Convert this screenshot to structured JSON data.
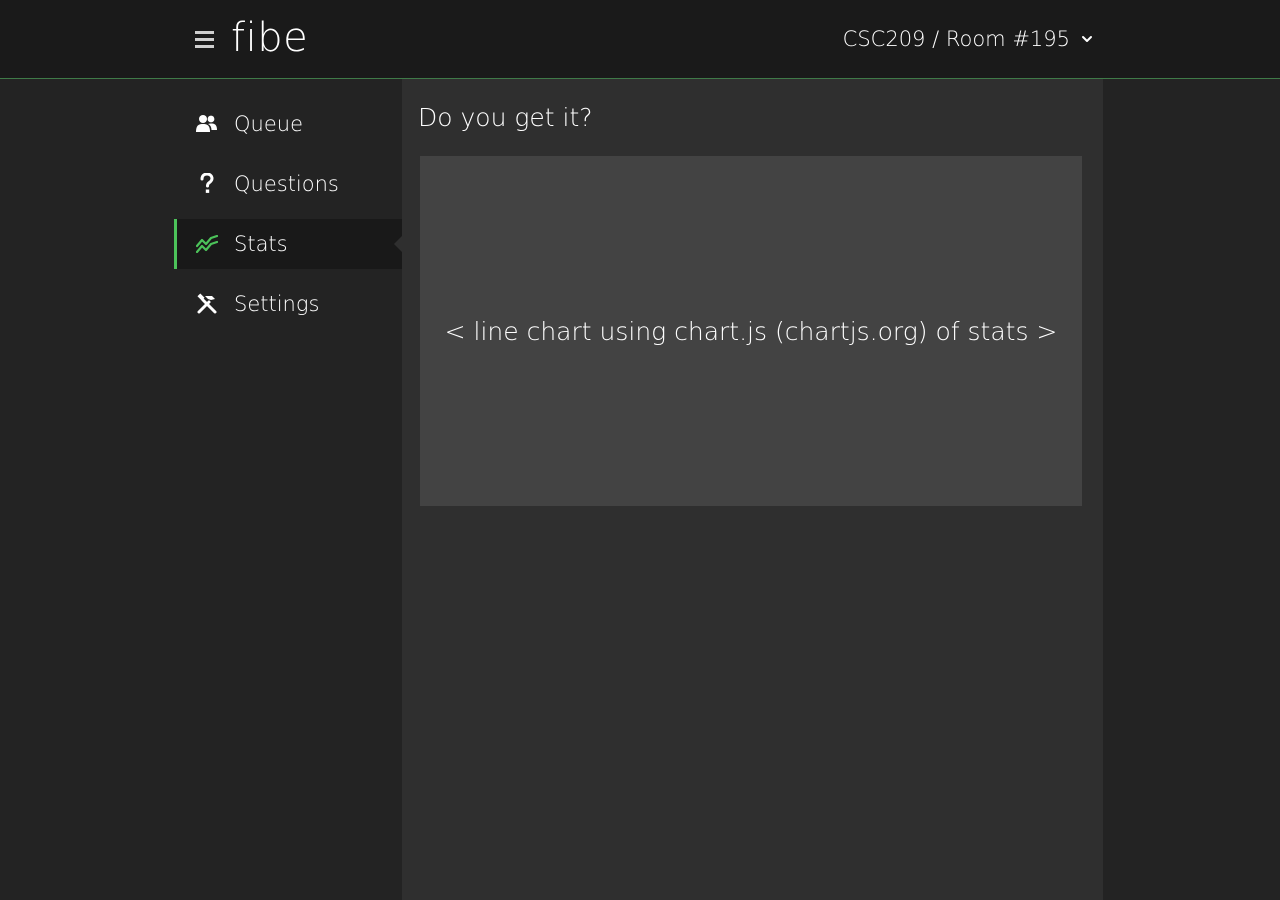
{
  "app": {
    "name": "fibe",
    "menu_icon": "hamburger-menu-icon"
  },
  "header": {
    "room_selector": "CSC209 / Room #195",
    "room_selector_icon": "chevron-down-icon",
    "accent_color": "#4cc35a"
  },
  "sidebar": {
    "items": [
      {
        "label": "Queue",
        "icon": "users-icon",
        "active": false
      },
      {
        "label": "Questions",
        "icon": "question-mark-icon",
        "active": false
      },
      {
        "label": "Stats",
        "icon": "line-chart-icon",
        "active": true
      },
      {
        "label": "Settings",
        "icon": "tools-icon",
        "active": false
      }
    ]
  },
  "main": {
    "title": "Do you get it?",
    "chart_placeholder": "< line chart using chart.js (chartjs.org) of stats >"
  }
}
